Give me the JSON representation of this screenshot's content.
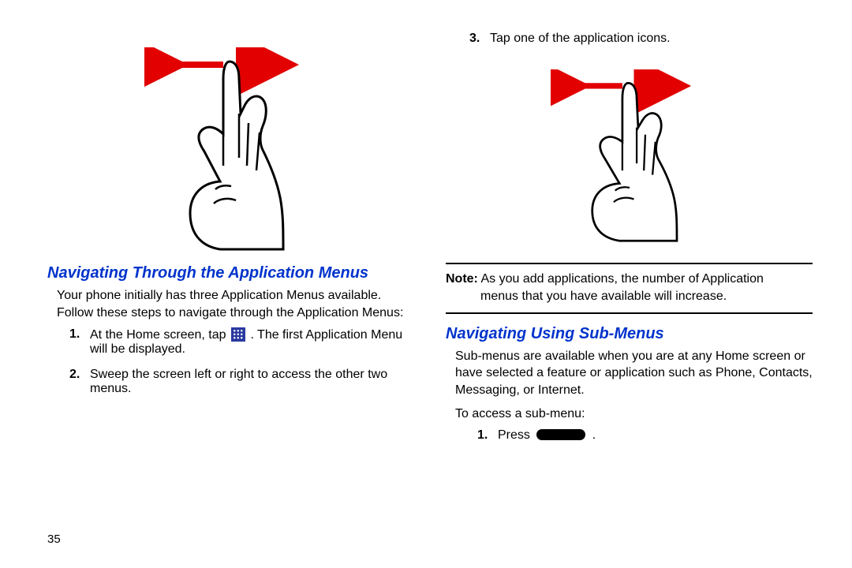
{
  "pageNumber": "35",
  "left": {
    "heading": "Navigating Through the Application Menus",
    "intro": "Your phone initially has three Application Menus available. Follow these steps to navigate through the Application Menus:",
    "steps": {
      "s1_num": "1.",
      "s1_a": "At the Home screen, tap ",
      "s1_b": ". The first Application Menu will be displayed.",
      "s2_num": "2.",
      "s2": "Sweep the screen left or right to access the other two menus."
    }
  },
  "right": {
    "topStep_num": "3.",
    "topStep": "Tap one of the application icons.",
    "note_label": "Note:",
    "note_line1": " As you add applications, the number of Application",
    "note_line2": "menus that you have available will increase.",
    "heading": "Navigating Using Sub-Menus",
    "intro": "Sub-menus are available when you are at any Home screen or have selected a feature or application such as Phone, Contacts, Messaging, or Internet.",
    "access": "To access a sub-menu:",
    "step1_num": "1.",
    "step1_a": "Press ",
    "step1_b": "."
  }
}
